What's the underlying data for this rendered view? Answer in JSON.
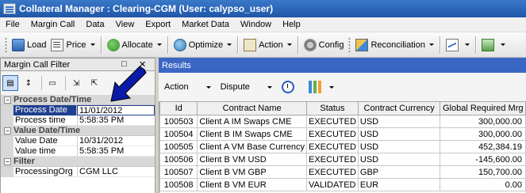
{
  "window": {
    "title": "Collateral Manager : Clearing-CGM (User: calypso_user)"
  },
  "menu": [
    "File",
    "Margin Call",
    "Data",
    "View",
    "Export",
    "Market Data",
    "Window",
    "Help"
  ],
  "toolbar": {
    "load": "Load",
    "price": "Price",
    "allocate": "Allocate",
    "optimize": "Optimize",
    "action": "Action",
    "config": "Config",
    "reconciliation": "Reconciliation"
  },
  "filter_panel": {
    "title": "Margin Call Filter",
    "pin_glyph": "□",
    "close_glyph": "✕",
    "categories": [
      {
        "label": "Process Date/Time",
        "toggle": "−",
        "rows": [
          {
            "name": "Process Date",
            "value": "11/01/2012"
          },
          {
            "name": "Process time",
            "value": "5:58:35 PM"
          }
        ]
      },
      {
        "label": "Value Date/Time",
        "toggle": "−",
        "rows": [
          {
            "name": "Value Date",
            "value": "10/31/2012"
          },
          {
            "name": "Value time",
            "value": "5:58:35 PM"
          }
        ]
      },
      {
        "label": "Filter",
        "toggle": "−",
        "rows": [
          {
            "name": "ProcessingOrg",
            "value": "CGM LLC"
          }
        ]
      }
    ]
  },
  "results": {
    "title": "Results",
    "action_label": "Action",
    "dispute_label": "Dispute",
    "columns": [
      "Id",
      "Contract Name",
      "Status",
      "Contract Currency",
      "Global Required Mrg"
    ],
    "rows": [
      [
        "100503",
        "Client A IM Swaps CME",
        "EXECUTED",
        "USD",
        "300,000.00"
      ],
      [
        "100504",
        "Client B IM Swaps CME",
        "EXECUTED",
        "USD",
        "300,000.00"
      ],
      [
        "100505",
        "Client A VM Base Currency",
        "EXECUTED",
        "USD",
        "452,384.19"
      ],
      [
        "100506",
        "Client B VM USD",
        "EXECUTED",
        "USD",
        "-145,600.00"
      ],
      [
        "100507",
        "Client B VM GBP",
        "EXECUTED",
        "GBP",
        "150,700.00"
      ],
      [
        "100508",
        "Client B VM EUR",
        "VALIDATED",
        "EUR",
        "0.00"
      ]
    ]
  },
  "colors": {
    "title_bar": "#1f56a8",
    "results_header": "#3b67c4",
    "selected_row": "#1f3f8f",
    "annotation_arrow": "#0a1aa8"
  }
}
